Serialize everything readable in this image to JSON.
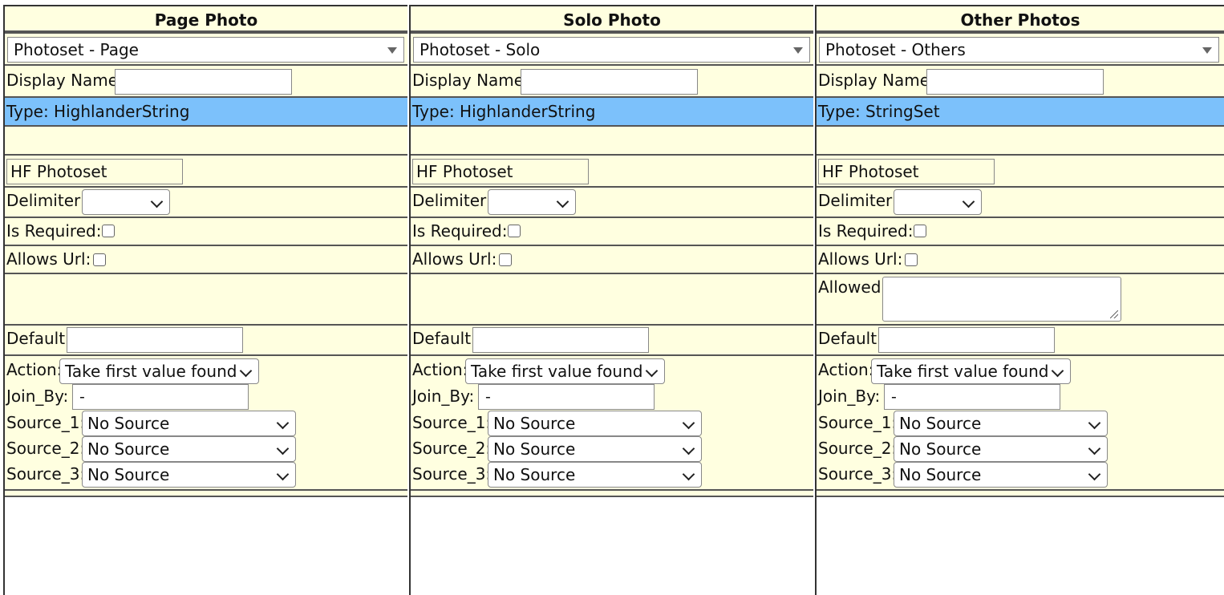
{
  "columns": [
    {
      "header": "Page Photo",
      "photoset": "Photoset - Page",
      "display_name_label": "Display Name:",
      "display_name_value": "",
      "type_text": "Type: HighlanderString",
      "hf_value": "HF Photoset",
      "delimiter_label": "Delimiter:",
      "delimiter_value": "",
      "is_required_label": "Is Required:",
      "is_required_checked": false,
      "allows_url_label": "Allows Url:",
      "allows_url_checked": false,
      "allowed_label": "",
      "default_label": "Default:",
      "default_value": "",
      "action_label": "Action:",
      "action_value": "Take first value found",
      "join_by_label": "Join_By:",
      "join_by_value": "-",
      "source1_label": "Source_1:",
      "source1_value": "No Source",
      "source2_label": "Source_2:",
      "source2_value": "No Source",
      "source3_label": "Source_3:",
      "source3_value": "No Source"
    },
    {
      "header": "Solo Photo",
      "photoset": "Photoset - Solo",
      "display_name_label": "Display Name:",
      "display_name_value": "",
      "type_text": "Type: HighlanderString",
      "hf_value": "HF Photoset",
      "delimiter_label": "Delimiter:",
      "delimiter_value": "",
      "is_required_label": "Is Required:",
      "is_required_checked": false,
      "allows_url_label": "Allows Url:",
      "allows_url_checked": false,
      "allowed_label": "",
      "default_label": "Default:",
      "default_value": "",
      "action_label": "Action:",
      "action_value": "Take first value found",
      "join_by_label": "Join_By:",
      "join_by_value": "-",
      "source1_label": "Source_1:",
      "source1_value": "No Source",
      "source2_label": "Source_2:",
      "source2_value": "No Source",
      "source3_label": "Source_3:",
      "source3_value": "No Source"
    },
    {
      "header": "Other Photos",
      "photoset": "Photoset - Others",
      "display_name_label": "Display Name:",
      "display_name_value": "",
      "type_text": "Type: StringSet",
      "hf_value": "HF Photoset",
      "delimiter_label": "Delimiter:",
      "delimiter_value": "",
      "is_required_label": "Is Required:",
      "is_required_checked": false,
      "allows_url_label": "Allows Url:",
      "allows_url_checked": false,
      "allowed_label": "Allowed:",
      "default_label": "Default:",
      "default_value": "",
      "action_label": "Action:",
      "action_value": "Take first value found",
      "join_by_label": "Join_By:",
      "join_by_value": "-",
      "source1_label": "Source_1:",
      "source1_value": "No Source",
      "source2_label": "Source_2:",
      "source2_value": "No Source",
      "source3_label": "Source_3:",
      "source3_value": "No Source"
    }
  ],
  "colors": {
    "row_background": "#ffffe0",
    "type_row_background": "#7cc1fb",
    "border": "#555555"
  }
}
